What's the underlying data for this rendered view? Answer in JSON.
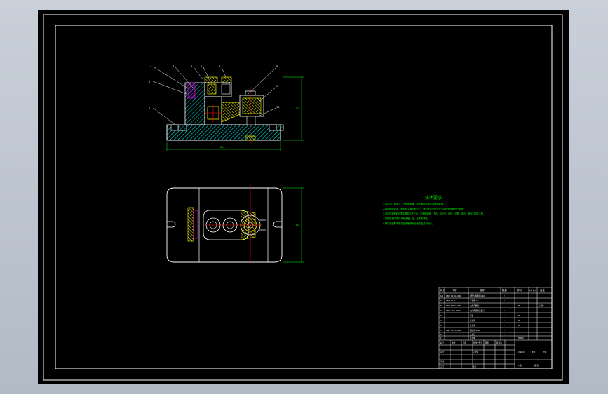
{
  "balloons": [
    "4",
    "3",
    "6",
    "5",
    "7",
    "8",
    "2",
    "9",
    "1",
    "10"
  ],
  "dimensions": {
    "front_width": "200",
    "front_height": "55",
    "top_height": "80"
  },
  "tech_notes": {
    "title": "技术要求",
    "lines": [
      "1.零件加工表面上，不应有划痕、擦伤等损伤零件表面的缺陷。",
      "2.装配前应对零、部件的主要配合尺寸，特别是过盈配合尺寸及相关精度进行复查。",
      "3.零件在装配前必须清理和清洗干净，不得有毛刺、飞边、氧化皮、锈蚀、切屑、油污、着色剂和灰尘等。",
      "4.装配过程中零件不允许磕、碰、划伤和锈蚀。",
      "5.螺钉紧固时严禁打击或使用不合适的旋具和扳手。"
    ]
  },
  "title_block": {
    "header": [
      "序号",
      "代号",
      "名称",
      "数量",
      "材料",
      "单件 总计",
      "备注"
    ],
    "header_weight": "重量",
    "rows": [
      [
        "10",
        "GB/T 6170-2000",
        "1型六角螺母 M10",
        "2",
        "",
        "",
        ""
      ],
      [
        "9",
        "GB/T 97.1",
        "平垫圈 10",
        "2",
        "",
        "",
        ""
      ],
      [
        "8",
        "GB/T 5782-2000",
        "六角头螺栓",
        "1",
        "45",
        "",
        "标准件"
      ],
      [
        "7",
        "GB/T 70.1-2000",
        "内六角圆柱头螺钉",
        "4",
        "",
        "",
        ""
      ],
      [
        "6",
        "",
        "压板",
        "1",
        "45",
        "",
        ""
      ],
      [
        "5",
        "",
        "定位销",
        "2",
        "45",
        "",
        ""
      ],
      [
        "4",
        "",
        "定位块",
        "1",
        "45",
        "",
        ""
      ],
      [
        "3",
        "GB/T 119.1-2000",
        "圆柱销 8x40",
        "2",
        "",
        "",
        ""
      ],
      [
        "2",
        "",
        "支承钉",
        "2",
        "",
        "",
        ""
      ],
      [
        "1",
        "",
        "夹具体",
        "1",
        "HT200",
        "",
        ""
      ]
    ],
    "bottom_labels": [
      "标记",
      "处数",
      "分区",
      "更改文件号",
      "签名",
      "年月日"
    ],
    "bottom_labels2": [
      "设计",
      "标准化",
      "阶段标记",
      "重量",
      "比例"
    ],
    "bottom_labels3": [
      "审核",
      "工艺",
      "批准",
      "共 张",
      "第 张"
    ]
  },
  "colors": {
    "background": "#000000",
    "frame": "#ffffff",
    "centerline": "#ff0000",
    "hatch": "#00bfbf",
    "dimension": "#00ff00",
    "yellow": "#ffff00",
    "magenta": "#ff00ff",
    "notes_text": "#00ff00"
  }
}
